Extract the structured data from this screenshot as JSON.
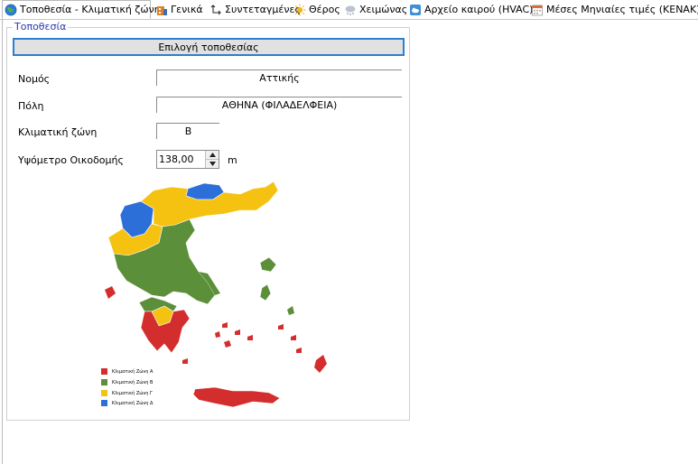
{
  "tabs": [
    {
      "label": "Τοποθεσία - Κλιματική ζώνη",
      "icon": "globe-icon",
      "active": true
    },
    {
      "label": "Γενικά",
      "icon": "building-icon"
    },
    {
      "label": "Συντεταγμένες",
      "icon": "axes-icon"
    },
    {
      "label": "Θέρος",
      "icon": "sun-icon"
    },
    {
      "label": "Χειμώνας",
      "icon": "snowflake-icon"
    },
    {
      "label": "Αρχείο καιρού (HVAC)",
      "icon": "weather-file-icon"
    },
    {
      "label": "Μέσες Μηνιαίες τιμές (KENAK)",
      "icon": "calendar-icon"
    }
  ],
  "location": {
    "group_title": "Τοποθεσία",
    "select_button": "Επιλογή τοποθεσίας",
    "prefecture_label": "Νομός",
    "prefecture_value": "Αττικής",
    "city_label": "Πόλη",
    "city_value": "ΑΘΗΝΑ (ΦΙΛΑΔΕΛΦΕΙΑ)",
    "zone_label": "Κλιματική ζώνη",
    "zone_value": "Β",
    "altitude_label": "Υψόμετρο Οικοδομής",
    "altitude_value": "138,00",
    "altitude_unit": "m"
  },
  "map_legend": [
    {
      "label": "Κλιματική Ζώνη Α",
      "color": "#d42d2d"
    },
    {
      "label": "Κλιματική Ζώνη Β",
      "color": "#5b8f3a"
    },
    {
      "label": "Κλιματική Ζώνη Γ",
      "color": "#f5c211"
    },
    {
      "label": "Κλιματική Ζώνη Δ",
      "color": "#2d6fd9"
    }
  ]
}
